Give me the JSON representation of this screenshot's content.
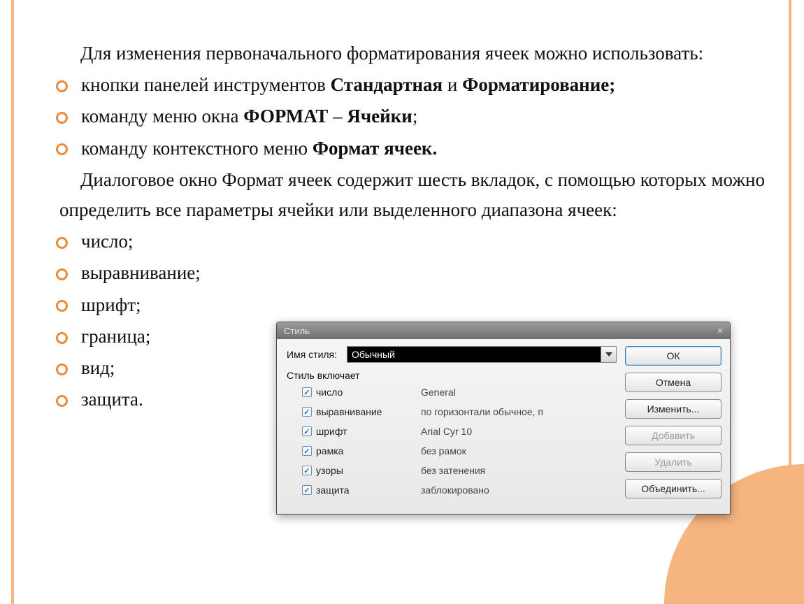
{
  "intro": "Для изменения первоначального форматирования ячеек можно использовать:",
  "bullets1": [
    {
      "pre": "кнопки панелей инструментов ",
      "b1": "Стандартная ",
      "mid": "и ",
      "b2": "Форматирование;",
      "post": ""
    },
    {
      "pre": "команду меню окна ",
      "b1": "ФОРМАТ",
      "mid": " – ",
      "b2": "Ячейки",
      "post": ";"
    },
    {
      "pre": "команду контекстного меню ",
      "b1": "Формат ячеек.",
      "mid": "",
      "b2": "",
      "post": ""
    }
  ],
  "para2": "Диалоговое окно Формат ячеек содержит шесть вкладок, с помощью которых можно определить все параметры ячейки или выделенного диапазона ячеек:",
  "bullets2": [
    "число;",
    "выравнивание;",
    "шрифт;",
    "граница;",
    "вид;",
    "защита."
  ],
  "dialog": {
    "title": "Стиль",
    "name_label": "Имя стиля:",
    "name_value": "Обычный",
    "group_label": "Стиль включает",
    "checks": [
      {
        "label": "число",
        "value": "General"
      },
      {
        "label": "выравнивание",
        "value": "по горизонтали обычное, п"
      },
      {
        "label": "шрифт",
        "value": "Arial Cyr 10"
      },
      {
        "label": "рамка",
        "value": "без рамок"
      },
      {
        "label": "узоры",
        "value": "без затенения"
      },
      {
        "label": "защита",
        "value": "заблокировано"
      }
    ],
    "buttons": {
      "ok": "ОК",
      "cancel": "Отмена",
      "modify": "Изменить...",
      "add": "Добавить",
      "delete": "Удалить",
      "merge": "Объединить..."
    }
  }
}
